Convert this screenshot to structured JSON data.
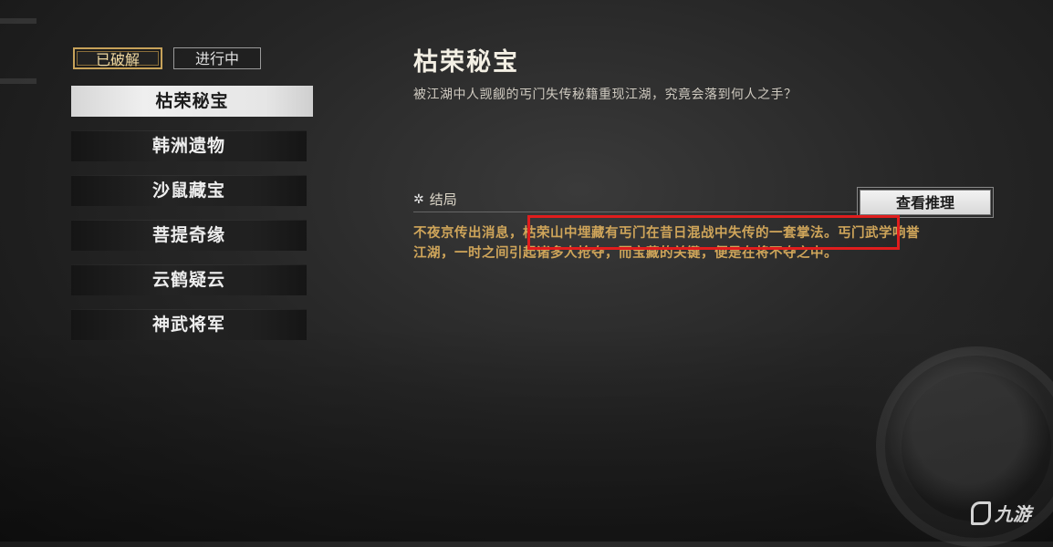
{
  "tabs": [
    {
      "label": "已破解",
      "active": true
    },
    {
      "label": "进行中",
      "active": false
    }
  ],
  "list": [
    {
      "label": "枯荣秘宝",
      "selected": true
    },
    {
      "label": "韩洲遗物",
      "selected": false
    },
    {
      "label": "沙鼠藏宝",
      "selected": false
    },
    {
      "label": "菩提奇缘",
      "selected": false
    },
    {
      "label": "云鹤疑云",
      "selected": false
    },
    {
      "label": "神武将军",
      "selected": false
    }
  ],
  "main": {
    "title": "枯荣秘宝",
    "description": "被江湖中人觊觎的丐门失传秘籍重现江湖，究竟会落到何人之手？",
    "section_icon": "snowflake-icon",
    "section_label": "结局",
    "reason_button": "查看推理",
    "result_line1": "不夜京传出消息，枯荣山中埋藏有丐门在昔日混战中失传的一套掌法。丐门武学响誉",
    "result_line2": "江湖，一时之间引起诸多人抢夺，而宝藏的关键，便是在将不夺之中。"
  },
  "colors": {
    "accent_gold": "#cfa55a",
    "highlight_red": "#e01d1d"
  },
  "watermark": {
    "text": "九游",
    "icon": "jiuyou-logo-icon"
  }
}
